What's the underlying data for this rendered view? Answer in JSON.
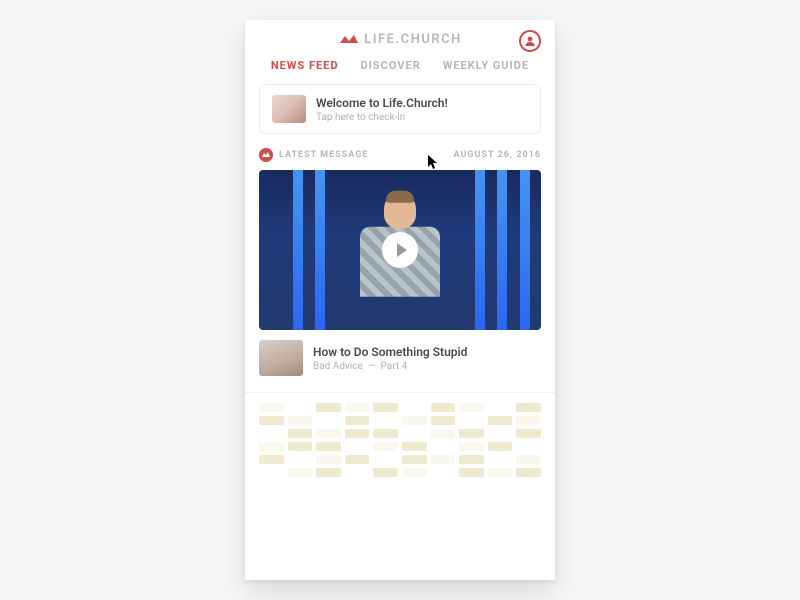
{
  "brand": {
    "name": "LIFE.CHURCH"
  },
  "tabs": [
    {
      "label": "NEWS FEED",
      "active": true
    },
    {
      "label": "DISCOVER",
      "active": false
    },
    {
      "label": "WEEKLY GUIDE",
      "active": false
    }
  ],
  "welcome": {
    "title": "Welcome to Life.Church!",
    "subtitle": "Tap here to check-in"
  },
  "section": {
    "label": "LATEST MESSAGE",
    "date": "AUGUST 26, 2016"
  },
  "message": {
    "title": "How to Do Something Stupid",
    "series": "Bad Advice",
    "divider": "—",
    "part": "Part 4"
  },
  "colors": {
    "accent": "#d24b4b",
    "muted": "#b6b6b6",
    "text": "#4a4a4a"
  }
}
